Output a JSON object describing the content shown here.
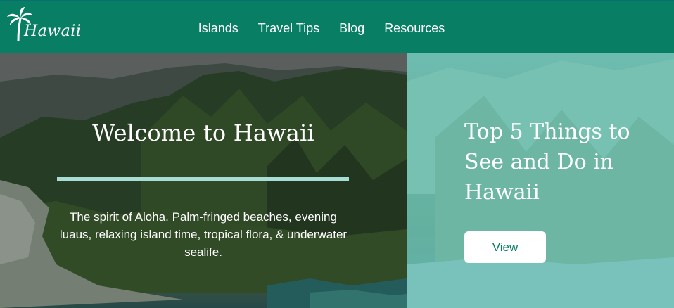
{
  "header": {
    "logo_text": "Hawaii",
    "logo_icon": "palm-tree-icon",
    "nav": [
      {
        "label": "Islands"
      },
      {
        "label": "Travel Tips"
      },
      {
        "label": "Blog"
      },
      {
        "label": "Resources"
      }
    ]
  },
  "hero": {
    "title": "Welcome to Hawaii",
    "description": "The spirit of Aloha. Palm-fringed beaches, evening luaus, relaxing island time, tropical flora, & underwater sealife."
  },
  "feature": {
    "title": "Top 5 Things to See and Do in Hawaii",
    "button_label": "View"
  },
  "colors": {
    "header_bg": "#087f64",
    "accent": "#a7ddd2",
    "button_text": "#087f64"
  }
}
